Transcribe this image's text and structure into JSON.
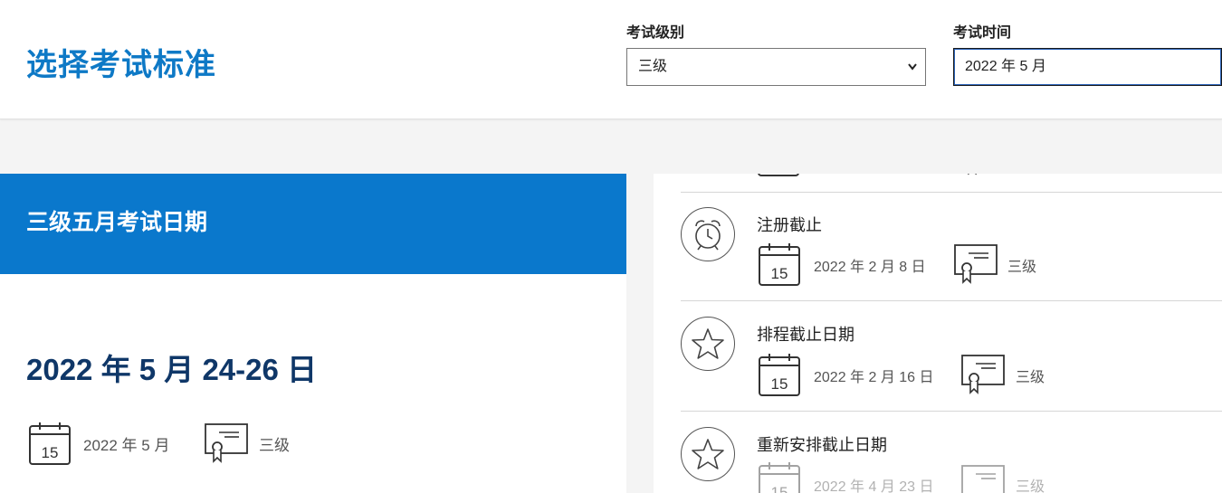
{
  "header": {
    "title": "选择考试标准",
    "level_label": "考试级别",
    "level_value": "三级",
    "time_label": "考试时间",
    "time_value": "2022 年 5 月"
  },
  "left_panel": {
    "heading": "三级五月考试日期",
    "date_range": "2022 年 5 月 24-26 日",
    "month": "2022 年 5 月",
    "level": "三级"
  },
  "events": [
    {
      "title": "注册截止",
      "icon": "alarm-clock-icon",
      "date": "2022 年 2 月 8 日",
      "level": "三级"
    },
    {
      "title": "排程截止日期",
      "icon": "star-icon",
      "date": "2022 年 2 月 16 日",
      "level": "三级"
    },
    {
      "title": "重新安排截止日期",
      "icon": "star-icon",
      "date": "2022 年 4 月 23 日",
      "level": "三级"
    }
  ],
  "calendar_icon_day": "15",
  "colors": {
    "brand_blue": "#0a78cc",
    "dark_navy": "#0f3768",
    "title_blue": "#0e79c6"
  }
}
